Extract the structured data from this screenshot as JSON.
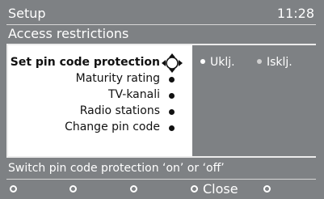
{
  "header": {
    "title": "Setup",
    "clock": "11:28"
  },
  "subtitle": "Access restrictions",
  "menu": {
    "items": [
      {
        "label": "Set pin code protection",
        "active": true
      },
      {
        "label": "Maturity rating"
      },
      {
        "label": "TV-kanali"
      },
      {
        "label": "Radio stations"
      },
      {
        "label": "Change pin code"
      }
    ]
  },
  "options": {
    "on_label": "Uklj.",
    "off_label": "Isklj."
  },
  "help": {
    "text": "Switch pin code protection ‘on’ or ‘off’"
  },
  "footer": {
    "close_label": "Close"
  },
  "icons": {
    "cursor": "navigation-cross-icon"
  },
  "colors": {
    "background": "#7e8184",
    "panel": "#ffffff",
    "text_dark": "#111111",
    "text_light": "#ffffff"
  }
}
